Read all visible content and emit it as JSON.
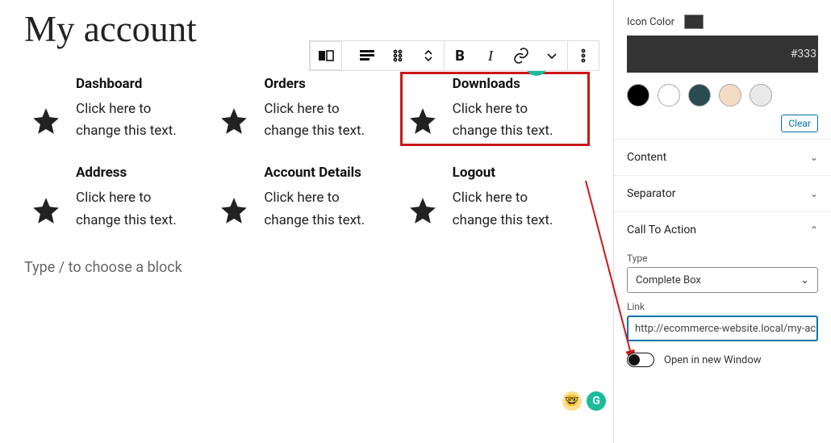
{
  "page": {
    "title": "My account",
    "placeholder": "Type / to choose a block"
  },
  "boxes": [
    {
      "title": "Dashboard",
      "desc": "Click here to change this text."
    },
    {
      "title": "Orders",
      "desc": "Click here to change this text."
    },
    {
      "title": "Downloads",
      "desc": "Click here to change this text."
    },
    {
      "title": "Address",
      "desc": "Click here to change this text."
    },
    {
      "title": "Account Details",
      "desc": "Click here to change this text."
    },
    {
      "title": "Logout",
      "desc": "Click here to change this text."
    }
  ],
  "toolbar": {
    "bold": "B",
    "italic": "I"
  },
  "sidebar": {
    "iconColorLabel": "Icon Color",
    "hex": "#333",
    "swatches": [
      "#000000",
      "#ffffff",
      "#2a4b4f",
      "#f3dbc4",
      "#e9e9e9"
    ],
    "clear": "Clear",
    "sections": {
      "content": "Content",
      "separator": "Separator",
      "cta": "Call To Action"
    },
    "typeLabel": "Type",
    "typeValue": "Complete Box",
    "linkLabel": "Link",
    "linkValue": "http://ecommerce-website.local/my-ac",
    "openNew": "Open in new Window"
  }
}
